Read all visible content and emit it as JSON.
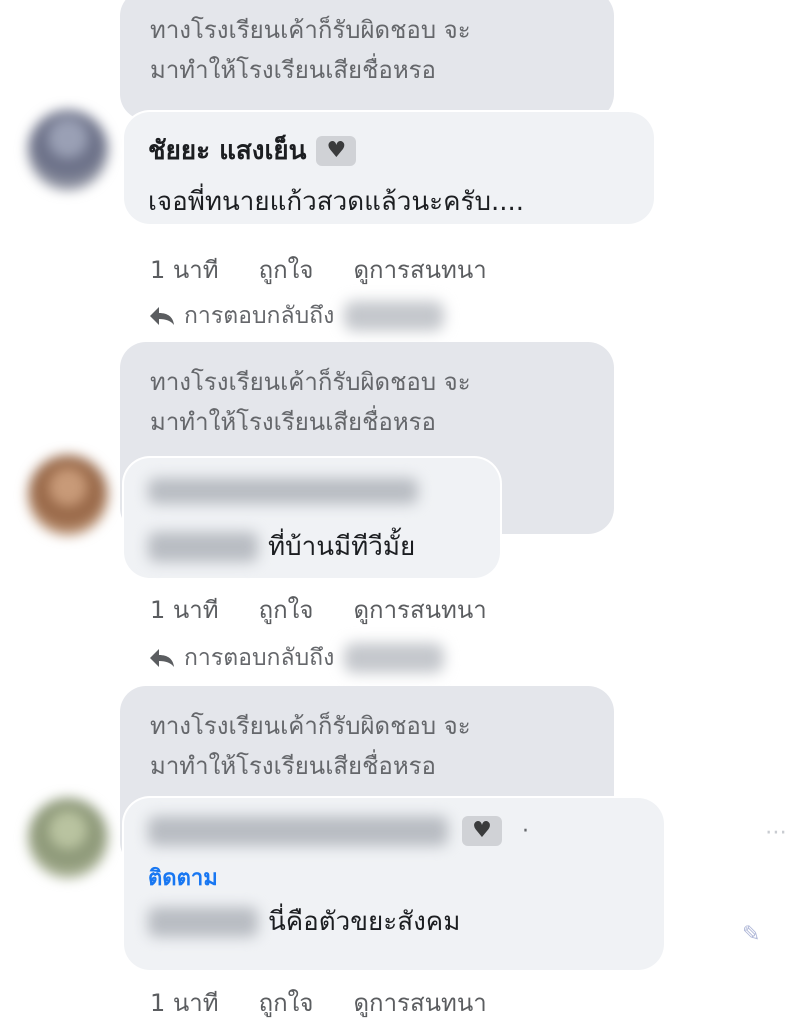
{
  "threads": [
    {
      "quote": {
        "line1": "ทางโรงเรียนเค้าก็รับผิดชอบ จะ",
        "line2": "มาทำให้โรงเรียนเสียชื่อหรอ"
      },
      "author": "ชัยยะ แสงเย็น",
      "badge_icon": "heart-icon",
      "text": "เจอพี่ทนายแก้วสวดแล้วนะครับ....",
      "actions": {
        "time": "1 นาที",
        "like": "ถูกใจ",
        "view_conversation": "ดูการสนทนา"
      },
      "reply_to": "การตอบกลับถึง"
    },
    {
      "quote": {
        "line1": "ทางโรงเรียนเค้าก็รับผิดชอบ จะ",
        "line2": "มาทำให้โรงเรียนเสียชื่อหรอ"
      },
      "text": "ที่บ้านมีทีวีมั้ย",
      "actions": {
        "time": "1 นาที",
        "like": "ถูกใจ",
        "view_conversation": "ดูการสนทนา"
      },
      "reply_to": "การตอบกลับถึง"
    },
    {
      "quote": {
        "line1": "ทางโรงเรียนเค้าก็รับผิดชอบ จะ",
        "line2": "มาทำให้โรงเรียนเสียชื่อหรอ"
      },
      "badge_icon": "heart-icon",
      "separator": "·",
      "follow": "ติดตาม",
      "text": "นี่คือตัวขยะสังคม",
      "actions": {
        "time": "1 นาที",
        "like": "ถูกใจ",
        "view_conversation": "ดูการสนทนา"
      }
    }
  ],
  "colors": {
    "quote_bg": "#e4e6eb",
    "bubble_bg": "#f0f2f5",
    "link_blue": "#1877f2",
    "muted_text": "#65676b"
  }
}
